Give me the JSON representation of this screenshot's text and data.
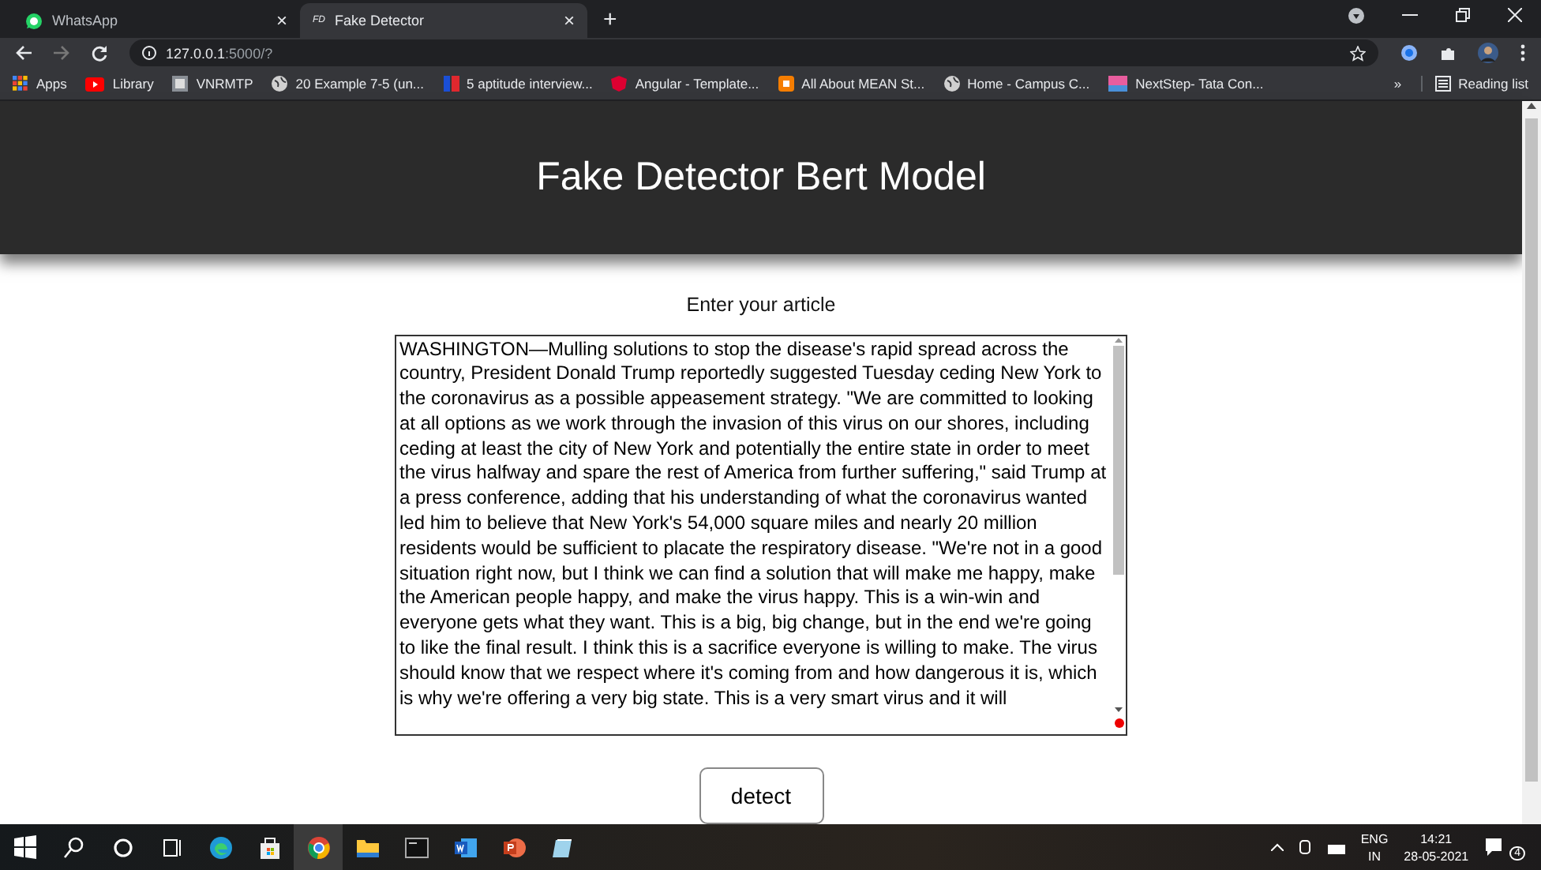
{
  "tabs": [
    {
      "label": "WhatsApp",
      "kind": "whatsapp",
      "selected": false,
      "close": "×"
    },
    {
      "label": "Fake Detector",
      "favicon": "FD",
      "kind": "text",
      "selected": true,
      "close": "×"
    }
  ],
  "new_tab": "+",
  "address": {
    "host": "127.0.0.1",
    "path": ":5000/?"
  },
  "bookmarks": [
    {
      "label": "Apps",
      "kind": "apps"
    },
    {
      "label": "Library",
      "kind": "youtube"
    },
    {
      "label": "VNRMTP",
      "kind": "square"
    },
    {
      "label": "20 Example 7-5 (un...",
      "kind": "globe"
    },
    {
      "label": "5 aptitude interview...",
      "kind": "tg"
    },
    {
      "label": "Angular - Template...",
      "kind": "angular"
    },
    {
      "label": "All About MEAN St...",
      "kind": "blogger"
    },
    {
      "label": "Home - Campus C...",
      "kind": "globe"
    },
    {
      "label": "NextStep- Tata Con...",
      "kind": "tcs"
    }
  ],
  "more": "»",
  "reading_list": "Reading list",
  "page": {
    "title": "Fake Detector Bert Model",
    "prompt": "Enter your article",
    "article": "WASHINGTON—Mulling solutions to stop the disease's rapid spread across the country, President Donald Trump reportedly suggested Tuesday ceding New York to the coronavirus as a possible appeasement strategy. \"We are committed to looking at all options as we work through the invasion of this virus on our shores, including ceding at least the city of New York and potentially the entire state in order to meet the virus halfway and spare the rest of America from further suffering,\" said Trump at a press conference, adding that his understanding of what the coronavirus wanted led him to believe that New York's 54,000 square miles and nearly 20 million residents would be sufficient to placate the respiratory disease. \"We're not in a good situation right now, but I think we can find a solution that will make me happy, make the American people happy, and make the virus happy. This is a win-win and everyone gets what they want. This is a big, big change, but in the end we're going to like the final result. I think this is a sacrifice everyone is willing to make. The virus should know that we respect where it's coming from and how dangerous it is, which is why we're offering a very big state. This is a very smart virus and it will",
    "button": "detect"
  },
  "taskbar": {
    "apps": [
      {
        "kind": "windows"
      },
      {
        "kind": "search"
      },
      {
        "kind": "cortana"
      },
      {
        "kind": "taskview"
      },
      {
        "kind": "edge"
      },
      {
        "kind": "store"
      },
      {
        "kind": "chrome",
        "selected": true
      },
      {
        "kind": "folder",
        "selected": false
      },
      {
        "kind": "terminal",
        "selected": false
      },
      {
        "kind": "word",
        "selected": false
      },
      {
        "kind": "powerpoint",
        "selected": false
      },
      {
        "kind": "notepad",
        "selected": false
      }
    ],
    "lang_top": "ENG",
    "lang_bottom": "IN",
    "time": "14:21",
    "date": "28-05-2021",
    "notifications": "4"
  }
}
